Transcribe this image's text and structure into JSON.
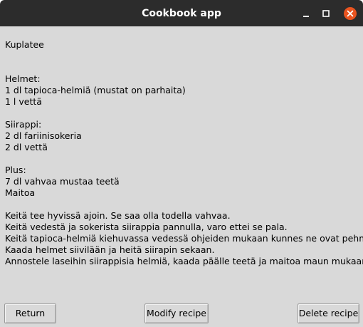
{
  "window": {
    "title": "Cookbook app"
  },
  "recipe": {
    "name": "Kuplatee",
    "sections": [
      {
        "heading": "Helmet:",
        "lines": [
          "1 dl tapioca-helmiä (mustat on parhaita)",
          "1 l vettä"
        ]
      },
      {
        "heading": "Siirappi:",
        "lines": [
          "2 dl fariinisokeria",
          "2 dl vettä"
        ]
      },
      {
        "heading": "Plus:",
        "lines": [
          "7 dl vahvaa mustaa teetä",
          "Maitoa"
        ]
      }
    ],
    "instructions": [
      "Keitä tee hyvissä ajoin. Se saa olla todella vahvaa.",
      "Keitä vedestä ja sokerista siirappia pannulla, varo ettei se pala.",
      "Keitä tapioca-helmiä kiehuvassa vedessä ohjeiden mukaan kunnes ne ovat pehmeitä.",
      "Kaada helmet siivilään ja heitä siirapin sekaan.",
      "Annostele laseihin siirappisia helmiä, kaada päälle teetä ja maitoa maun mukaan."
    ]
  },
  "buttons": {
    "return_label": "Return",
    "modify_label": "Modify recipe",
    "delete_label": "Delete recipe"
  },
  "icons": {
    "minimize": "minimize-icon",
    "maximize": "maximize-icon",
    "close": "close-icon"
  },
  "colors": {
    "titlebar": "#2c2c2c",
    "window_bg": "#d9d9d9",
    "close_button": "#e95420"
  }
}
